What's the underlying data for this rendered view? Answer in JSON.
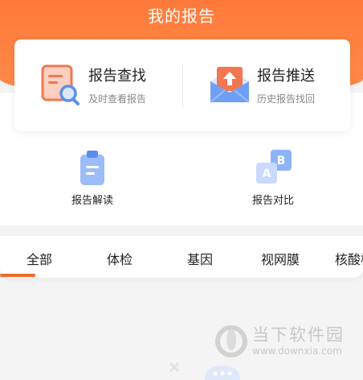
{
  "page": {
    "title": "我的报告"
  },
  "card": {
    "search": {
      "title": "报告查找",
      "subtitle": "及时查看报告",
      "icon": "report-search-icon"
    },
    "push": {
      "title": "报告推送",
      "subtitle": "历史报告找回",
      "icon": "report-push-icon"
    }
  },
  "features": [
    {
      "label": "报告解读",
      "icon": "clipboard-icon"
    },
    {
      "label": "报告对比",
      "icon": "ab-compare-icon"
    }
  ],
  "tabs": [
    {
      "label": "全部"
    },
    {
      "label": "体检"
    },
    {
      "label": "基因"
    },
    {
      "label": "视网膜"
    },
    {
      "label": "核酸检"
    }
  ],
  "watermark": {
    "name": "当下软件园",
    "url": "www.downxia.com"
  },
  "colors": {
    "accent": "#f06a2a",
    "header": "#ff7a3a",
    "icon_blue": "#5b8ef0"
  }
}
